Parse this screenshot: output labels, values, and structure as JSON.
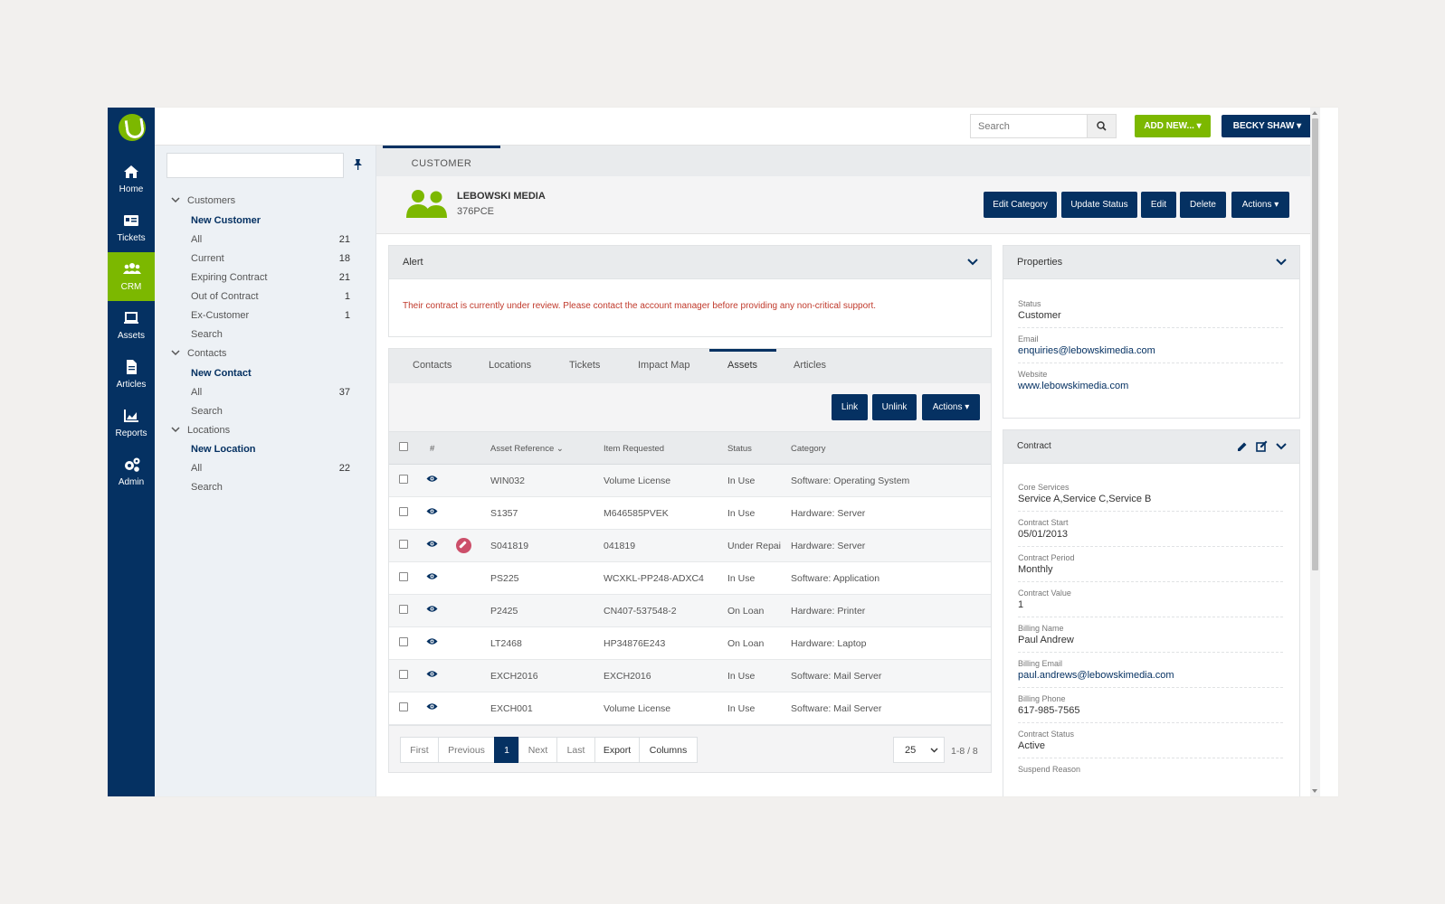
{
  "rail": {
    "items": [
      {
        "label": "Home",
        "icon": "home-icon"
      },
      {
        "label": "Tickets",
        "icon": "ticket-icon"
      },
      {
        "label": "CRM",
        "icon": "users-icon",
        "active": true
      },
      {
        "label": "Assets",
        "icon": "laptop-icon"
      },
      {
        "label": "Articles",
        "icon": "document-icon"
      },
      {
        "label": "Reports",
        "icon": "chart-icon"
      },
      {
        "label": "Admin",
        "icon": "cogs-icon"
      }
    ]
  },
  "topbar": {
    "search_placeholder": "Search",
    "add_new_label": "ADD NEW...",
    "user_label": "BECKY SHAW"
  },
  "tree": {
    "customers": {
      "title": "Customers",
      "new_label": "New Customer",
      "items": [
        {
          "label": "All",
          "count": "21"
        },
        {
          "label": "Current",
          "count": "18"
        },
        {
          "label": "Expiring Contract",
          "count": "21"
        },
        {
          "label": "Out of Contract",
          "count": "1"
        },
        {
          "label": "Ex-Customer",
          "count": "1"
        },
        {
          "label": "Search",
          "count": ""
        }
      ]
    },
    "contacts": {
      "title": "Contacts",
      "new_label": "New Contact",
      "items": [
        {
          "label": "All",
          "count": "37"
        },
        {
          "label": "Search",
          "count": ""
        }
      ]
    },
    "locations": {
      "title": "Locations",
      "new_label": "New Location",
      "items": [
        {
          "label": "All",
          "count": "22"
        },
        {
          "label": "Search",
          "count": ""
        }
      ]
    }
  },
  "main": {
    "tab_label": "CUSTOMER",
    "customer": {
      "name": "LEBOWSKI MEDIA",
      "code": "376PCE"
    },
    "header_buttons": {
      "edit_category": "Edit Category",
      "update_status": "Update Status",
      "edit": "Edit",
      "delete": "Delete",
      "actions": "Actions"
    },
    "alert": {
      "title": "Alert",
      "text": "Their contract is currently under review. Please contact the account manager before providing any non-critical support."
    },
    "subtabs": [
      "Contacts",
      "Locations",
      "Tickets",
      "Impact Map",
      "Assets",
      "Articles"
    ],
    "active_subtab": "Assets",
    "asset_buttons": {
      "link": "Link",
      "unlink": "Unlink",
      "actions": "Actions"
    },
    "table": {
      "headers": [
        "#",
        "Asset Reference",
        "Item Requested",
        "Status",
        "Category"
      ],
      "rows": [
        {
          "ref": "WIN032",
          "item": "Volume License",
          "status": "In Use",
          "category": "Software: Operating System",
          "flag": false
        },
        {
          "ref": "S1357",
          "item": "M646585PVEK",
          "status": "In Use",
          "category": "Hardware: Server",
          "flag": false
        },
        {
          "ref": "S041819",
          "item": "041819",
          "status": "Under Repai",
          "category": "Hardware: Server",
          "flag": true
        },
        {
          "ref": "PS225",
          "item": "WCXKL-PP248-ADXC4",
          "status": "In Use",
          "category": "Software: Application",
          "flag": false
        },
        {
          "ref": "P2425",
          "item": "CN407-537548-2",
          "status": "On Loan",
          "category": "Hardware: Printer",
          "flag": false
        },
        {
          "ref": "LT2468",
          "item": "HP34876E243",
          "status": "On Loan",
          "category": "Hardware: Laptop",
          "flag": false
        },
        {
          "ref": "EXCH2016",
          "item": "EXCH2016",
          "status": "In Use",
          "category": "Software: Mail Server",
          "flag": false
        },
        {
          "ref": "EXCH001",
          "item": "Volume License",
          "status": "In Use",
          "category": "Software: Mail Server",
          "flag": false
        }
      ]
    },
    "pager": {
      "first": "First",
      "previous": "Previous",
      "current": "1",
      "next": "Next",
      "last": "Last",
      "export": "Export",
      "columns": "Columns",
      "page_size": "25",
      "info": "1-8 / 8"
    }
  },
  "properties": {
    "title": "Properties",
    "fields": [
      {
        "label": "Status",
        "value": "Customer",
        "link": false
      },
      {
        "label": "Email",
        "value": "enquiries@lebowskimedia.com",
        "link": true
      },
      {
        "label": "Website",
        "value": "www.lebowskimedia.com",
        "link": true
      }
    ]
  },
  "contract": {
    "title": "Contract",
    "fields": [
      {
        "label": "Core Services",
        "value": "Service A,Service C,Service B",
        "link": false
      },
      {
        "label": "Contract Start",
        "value": "05/01/2013",
        "link": false
      },
      {
        "label": "Contract Period",
        "value": "Monthly",
        "link": false
      },
      {
        "label": "Contract Value",
        "value": "1",
        "link": false
      },
      {
        "label": "Billing Name",
        "value": "Paul Andrew",
        "link": false
      },
      {
        "label": "Billing Email",
        "value": "paul.andrews@lebowskimedia.com",
        "link": true
      },
      {
        "label": "Billing Phone",
        "value": "617-985-7565",
        "link": false
      },
      {
        "label": "Contract Status",
        "value": "Active",
        "link": false
      },
      {
        "label": "Suspend Reason",
        "value": "",
        "link": false
      }
    ]
  },
  "colors": {
    "navy": "#053162",
    "green": "#7cb800",
    "alert": "#c0392b"
  }
}
